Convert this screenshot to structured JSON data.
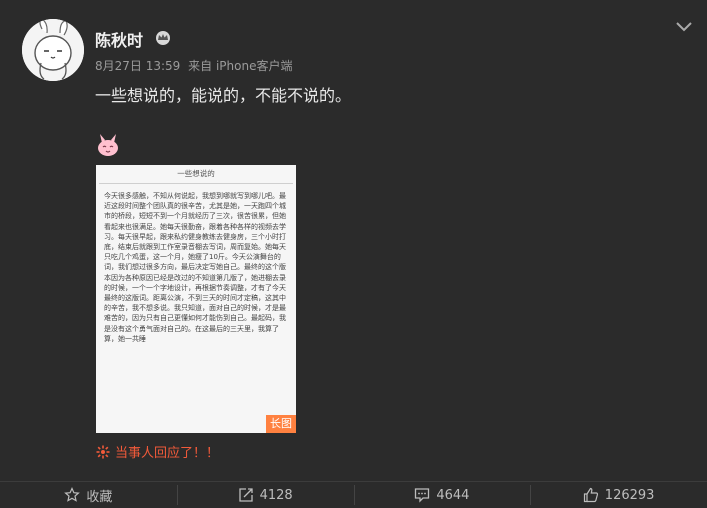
{
  "post": {
    "user_name": "陈秋时",
    "date": "8月27日 13:59",
    "source": "来自 iPhone客户端",
    "text": "一些想说的，能说的，不能不说的。",
    "image": {
      "title": "一些想说的",
      "body": "今天很多感触，不知从何说起，我想到哪就写到哪儿吧。最近这段时间整个团队真的很辛苦，尤其是她，一天跑四个城市的桥段，短短不到一个月就经历了三次，很苦很累，但她看起来也很满足。她每天很勤奋，跟着各种各样的视频去学习。每天很早起，跟来私约健身教练去健身房，三个小时打底，结束后就跟到工作室录音棚去写词，周而复始。她每天只吃几个鸡蛋，这一个月，她瘦了10斤。今天公演舞台的词，我们想过很多方向，最后决定写她自己。最终的这个版本因为各种原因已经是改过的不知道第几版了，她进棚去录的时候，一个一个字地设计，再根据节奏调整，才有了今天最终的这版词。距离公演，不到三天的时间才定稿，这其中的辛苦，我不想多说。我只知道，面对自己的时候，才是最难苦的，因为只有自己更懂如何才能伤到自己。最起码，我是没有这个勇气面对自己的。在这最后的三天里，我算了算，她一共睡",
      "badge": "长图"
    },
    "reply_text": "当事人回应了！！"
  },
  "actions": {
    "favorite_label": "收藏",
    "repost_count": "4128",
    "comment_count": "4644",
    "like_count": "126293"
  },
  "colors": {
    "background": "#2b2b2b",
    "reply": "#f25a3a",
    "badge": "#ff8140"
  },
  "icons": [
    "avatar-rabbit",
    "crown-icon",
    "chevron-down-icon",
    "bunny-emoji-icon",
    "star-icon",
    "repost-icon",
    "comment-icon",
    "like-icon",
    "sparkle-icon"
  ]
}
